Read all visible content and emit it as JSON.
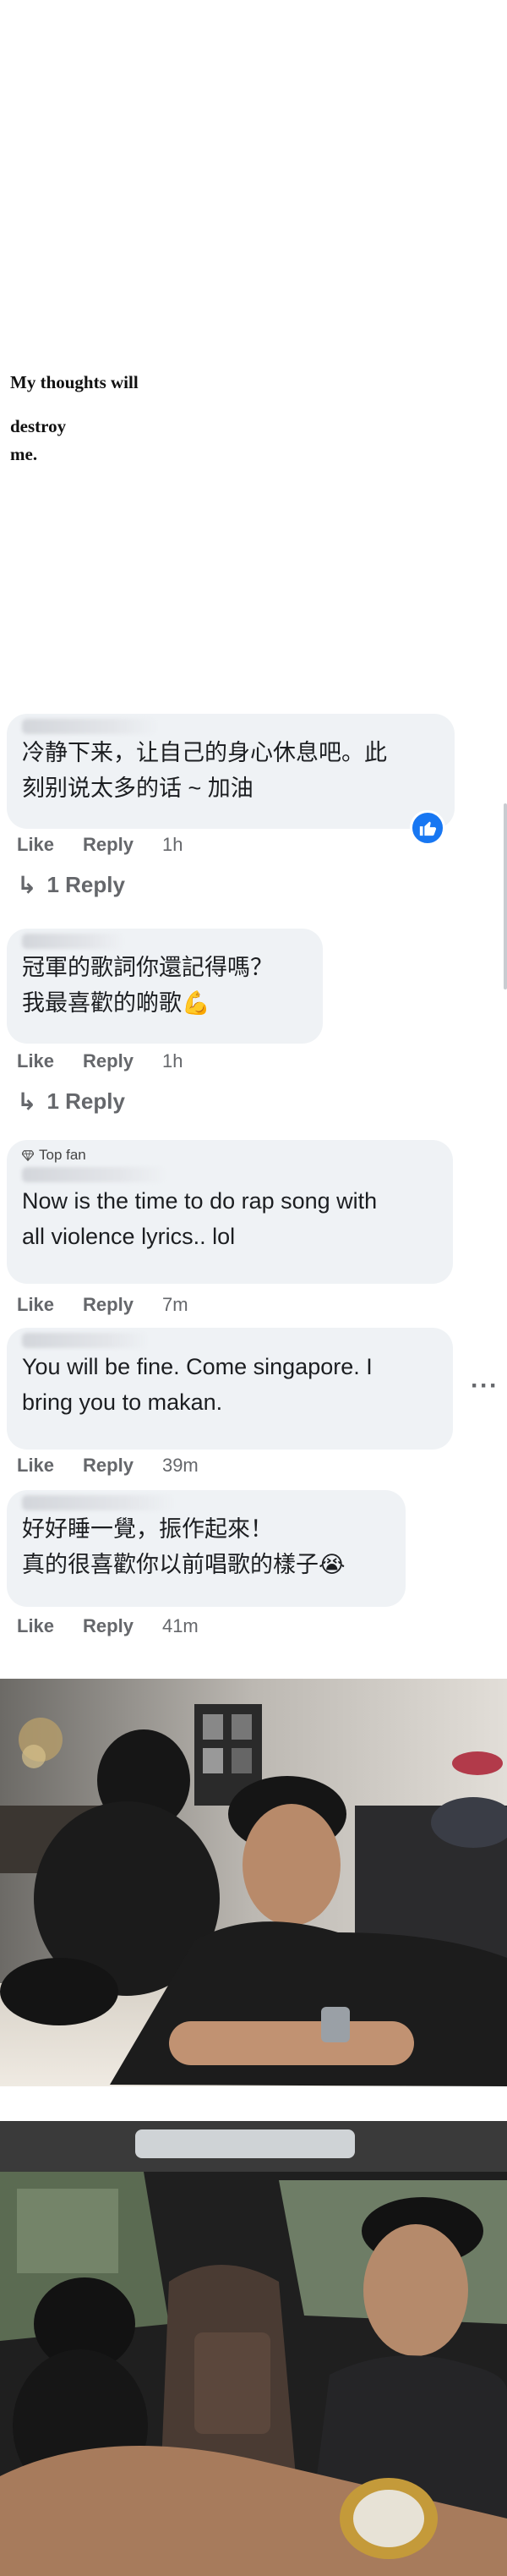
{
  "quote": {
    "line1": "My thoughts will",
    "line2": "destroy",
    "line3": "me."
  },
  "comments": [
    {
      "text": "冷静下来，让自己的身心休息吧。此\n刻别说太多的话 ~ 加油",
      "like": "Like",
      "reply": "Reply",
      "time": "1h",
      "replies_label": "1 Reply",
      "reaction_icon": "thumbs-up-icon"
    },
    {
      "text": "冠軍的歌詞你還記得嗎？\n我最喜歡的啲歌💪",
      "like": "Like",
      "reply": "Reply",
      "time": "1h",
      "replies_label": "1 Reply"
    },
    {
      "badge": "Top fan",
      "text": "Now is the time to do rap song with\nall violence lyrics.. lol",
      "like": "Like",
      "reply": "Reply",
      "time": "7m"
    },
    {
      "text": "You will be fine. Come singapore. I\nbring you to makan.",
      "like": "Like",
      "reply": "Reply",
      "time": "39m",
      "more_icon": "more-options-icon"
    },
    {
      "text": "好好睡一覺，振作起來！\n真的很喜歡你以前唱歌的樣子😭",
      "like": "Like",
      "reply": "Reply",
      "time": "41m"
    }
  ],
  "colors": {
    "bubble": "#eff2f5",
    "meta": "#65676b",
    "text": "#1c1e21",
    "facebook_blue": "#1877f2"
  },
  "photos": [
    {
      "subject": "man lying on rug with black poodle"
    },
    {
      "subject": "man in car with black poodle"
    }
  ]
}
